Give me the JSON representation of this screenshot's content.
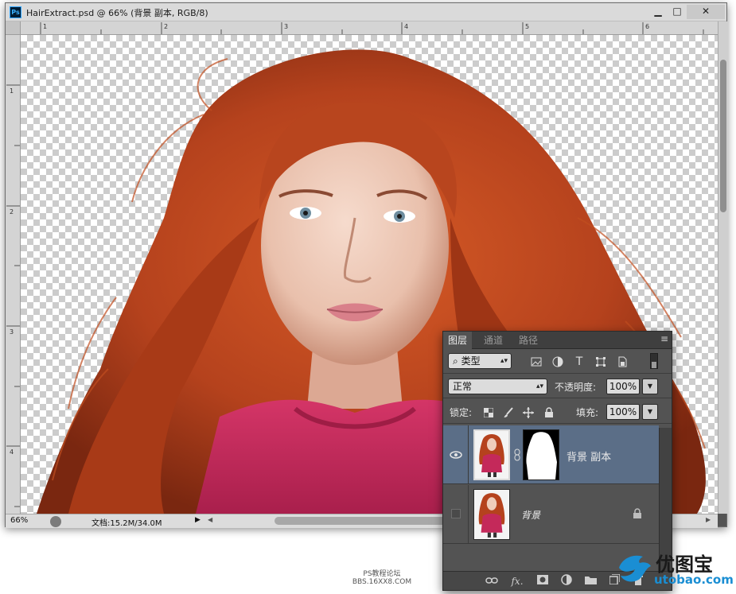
{
  "window": {
    "title": "HairExtract.psd @ 66% (背景 副本, RGB/8)",
    "app_icon": "Ps",
    "controls": {
      "minimize": "▁",
      "maximize": "□",
      "close": "✕"
    }
  },
  "rulers": {
    "top": [
      "1",
      "2",
      "3",
      "4",
      "5",
      "6"
    ],
    "left": [
      "1",
      "2",
      "3",
      "4"
    ]
  },
  "statusbar": {
    "zoom": "66%",
    "doc_info": "文档:15.2M/34.0M",
    "play": "▶",
    "scroll_left": "◀",
    "scroll_right": "▶"
  },
  "layers_panel": {
    "tabs": [
      "图层",
      "通道",
      "路径"
    ],
    "active_tab": "图层",
    "menu_icon": "≡",
    "filter": {
      "icon": "⌕",
      "label": "类型"
    },
    "blend_mode": "正常",
    "opacity": {
      "label": "不透明度:",
      "value": "100%"
    },
    "lock": {
      "label": "锁定:"
    },
    "fill": {
      "label": "填充:",
      "value": "100%"
    },
    "layers": [
      {
        "name": "背景 副本",
        "visible": true,
        "selected": true,
        "has_mask": true
      },
      {
        "name": "背景",
        "visible": false,
        "selected": false,
        "locked": true
      }
    ],
    "footer_icons": [
      "link-icon",
      "fx-icon",
      "mask-icon",
      "adjustment-icon",
      "folder-icon",
      "new-layer-icon",
      "trash-icon"
    ],
    "footer_fx": "fx."
  },
  "watermarks": {
    "forum_line1": "PS教程论坛",
    "forum_line2": "BBS.16XX8.COM",
    "brand": "优图宝",
    "brand_url": "utobao.com"
  },
  "colors": {
    "hair": "#b5421d",
    "shirt": "#c4295a",
    "selected_layer": "#5b6e87",
    "panel_bg": "#535353"
  }
}
